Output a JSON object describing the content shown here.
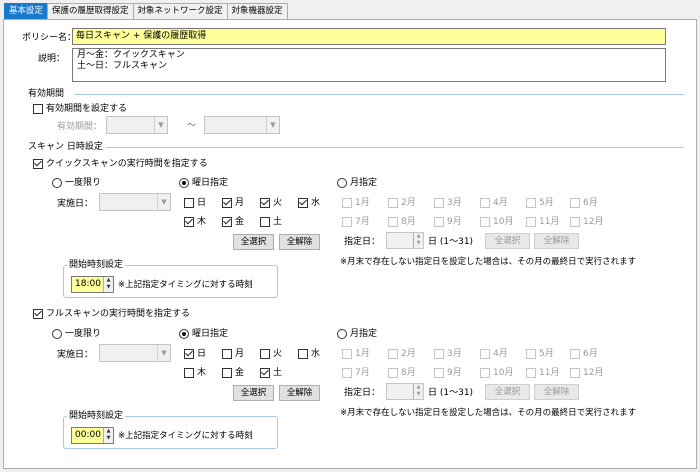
{
  "tabs": [
    "基本設定",
    "保護の履歴取得設定",
    "対象ネットワーク設定",
    "対象機器設定"
  ],
  "policy": {
    "name_label": "ポリシー名：",
    "name_value": "毎日スキャン + 保護の履歴取得",
    "desc_label": "説明：",
    "desc_lines": [
      "月～金：クイックスキャン",
      "土～日：フルスキャン"
    ]
  },
  "validity": {
    "section_title": "有効期間",
    "checkbox_label": "有効期間を設定する",
    "period_label": "有効期間：",
    "tilde": "～"
  },
  "scan": {
    "section_title": "スキャン 日時設定",
    "quick": {
      "checkbox_label": "クイックスキャンの実行時間を指定する",
      "radio_once": "一度限り",
      "radio_weekday": "曜日指定",
      "radio_month": "月指定",
      "date_label": "実施日：",
      "days": [
        "日",
        "月",
        "火",
        "水",
        "木",
        "金",
        "土"
      ],
      "days_checked": [
        false,
        true,
        true,
        true,
        true,
        true,
        false
      ],
      "select_all": "全選択",
      "clear_all": "全解除",
      "months": [
        "1月",
        "2月",
        "3月",
        "4月",
        "5月",
        "6月",
        "7月",
        "8月",
        "9月",
        "10月",
        "11月",
        "12月"
      ],
      "day_label": "指定日：",
      "day_range": "日 (1～31)",
      "note": "※月末で存在しない指定日を設定した場合は、その月の最終日で実行されます",
      "start_title": "開始時刻設定",
      "start_time": "18:00",
      "start_note": "※上記指定タイミングに対する時刻"
    },
    "full": {
      "checkbox_label": "フルスキャンの実行時間を指定する",
      "radio_once": "一度限り",
      "radio_weekday": "曜日指定",
      "radio_month": "月指定",
      "date_label": "実施日：",
      "days": [
        "日",
        "月",
        "火",
        "水",
        "木",
        "金",
        "土"
      ],
      "days_checked": [
        true,
        false,
        false,
        false,
        false,
        false,
        true
      ],
      "select_all": "全選択",
      "clear_all": "全解除",
      "months": [
        "1月",
        "2月",
        "3月",
        "4月",
        "5月",
        "6月",
        "7月",
        "8月",
        "9月",
        "10月",
        "11月",
        "12月"
      ],
      "day_label": "指定日：",
      "day_range": "日 (1～31)",
      "note": "※月末で存在しない指定日を設定した場合は、その月の最終日で実行されます",
      "start_title": "開始時刻設定",
      "start_time": "00:00",
      "start_note": "※上記指定タイミングに対する時刻"
    }
  }
}
